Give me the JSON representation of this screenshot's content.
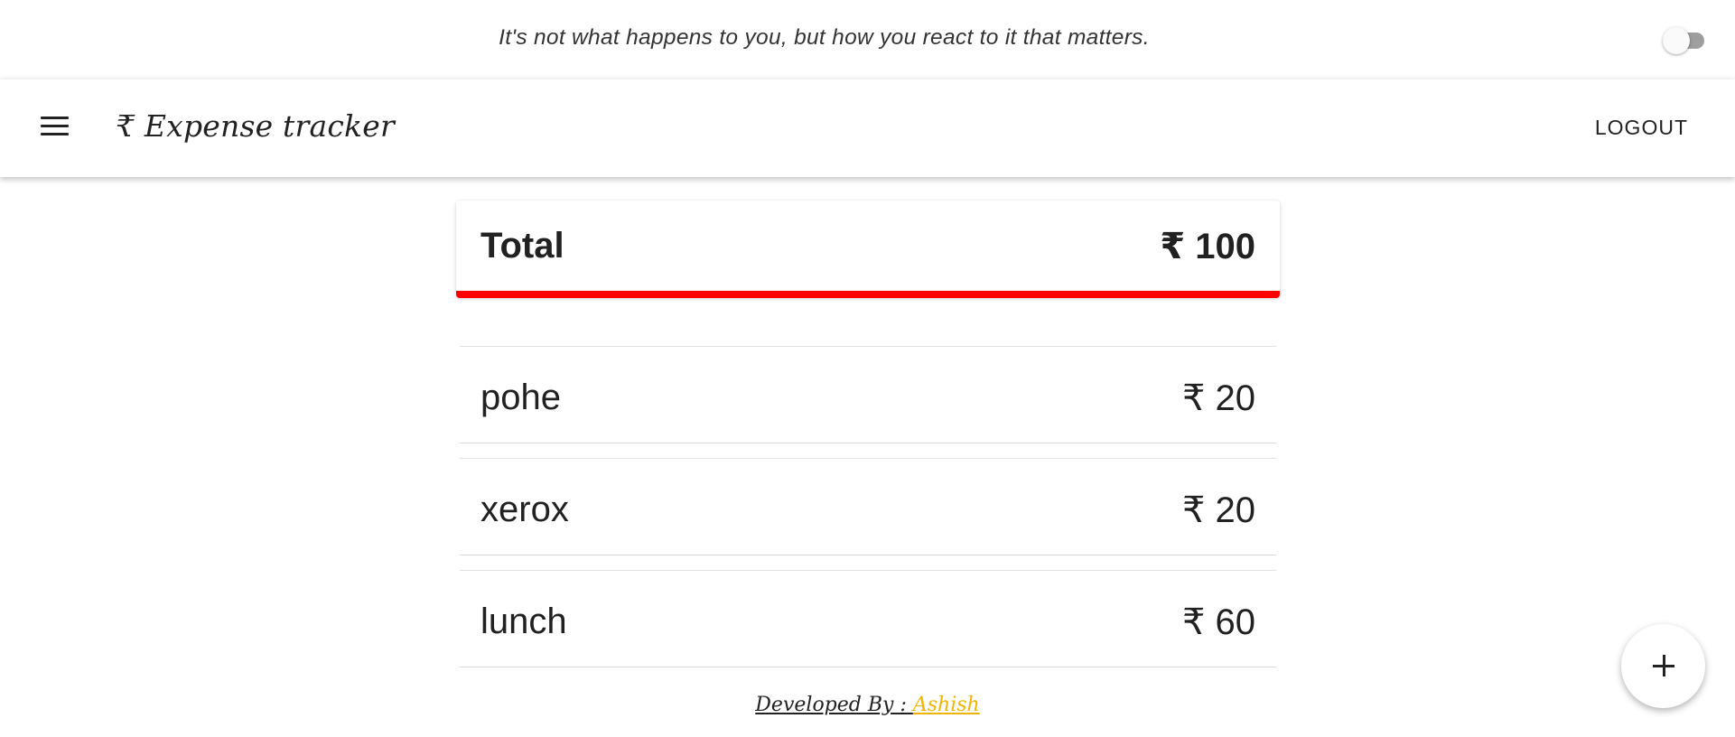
{
  "quote": "It's not what happens to you, but how you react to it that matters.",
  "theme_toggle": {
    "on": false
  },
  "appbar": {
    "brand": "₹ Expense tracker",
    "logout_label": "LOGOUT",
    "menu_icon": "menu-icon"
  },
  "total": {
    "label": "Total",
    "amount": "₹ 100",
    "accent_color": "#ff0000"
  },
  "expenses": [
    {
      "name": "pohe",
      "amount": "₹ 20"
    },
    {
      "name": "xerox",
      "amount": "₹ 20"
    },
    {
      "name": "lunch",
      "amount": "₹ 60"
    }
  ],
  "footer": {
    "prefix": "Developed By : ",
    "author": "Ashish",
    "author_color": "#f0b400"
  },
  "fab": {
    "icon": "plus-icon"
  }
}
